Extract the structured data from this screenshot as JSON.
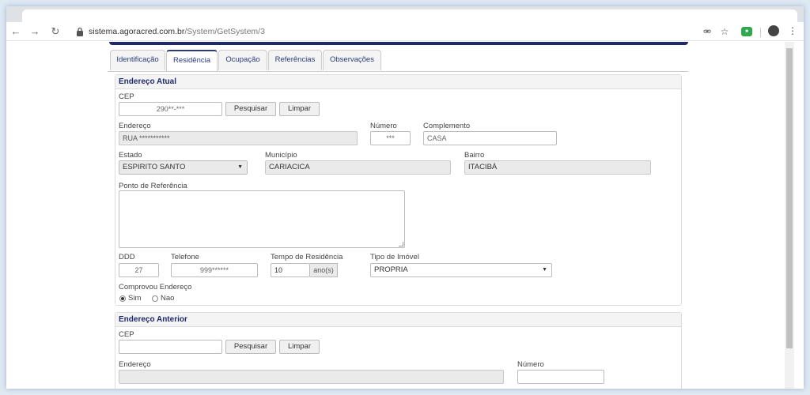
{
  "browser": {
    "url_host": "sistema.agoracred.com.br",
    "url_path": "/System/GetSystem/3"
  },
  "tabs": [
    {
      "label": "Identificação",
      "active": false
    },
    {
      "label": "Residência",
      "active": true
    },
    {
      "label": "Ocupação",
      "active": false
    },
    {
      "label": "Referências",
      "active": false
    },
    {
      "label": "Observações",
      "active": false
    }
  ],
  "endereco_atual": {
    "title": "Endereço Atual",
    "cep_label": "CEP",
    "cep_value": "290**-***",
    "pesquisar_label": "Pesquisar",
    "limpar_label": "Limpar",
    "endereco_label": "Endereço",
    "endereco_value": "RUA ***********",
    "numero_label": "Número",
    "numero_value": "***",
    "complemento_label": "Complemento",
    "complemento_value": "CASA",
    "estado_label": "Estado",
    "estado_value": "ESPIRITO SANTO",
    "municipio_label": "Município",
    "municipio_value": "CARIACICA",
    "bairro_label": "Bairro",
    "bairro_value": "ITACIBÁ",
    "referencia_label": "Ponto de Referência",
    "ddd_label": "DDD",
    "ddd_value": "27",
    "telefone_label": "Telefone",
    "telefone_value": "999******",
    "tempo_label": "Tempo de Residência",
    "tempo_value": "10",
    "tempo_unit": "ano(s)",
    "tipo_label": "Tipo de Imóvel",
    "tipo_value": "PROPRIA",
    "comprovou_label": "Comprovou Endereço",
    "sim_label": "Sim",
    "nao_label": "Nao",
    "comprovou_selected": "Sim"
  },
  "endereco_anterior": {
    "title": "Endereço Anterior",
    "cep_label": "CEP",
    "cep_value": "",
    "pesquisar_label": "Pesquisar",
    "limpar_label": "Limpar",
    "endereco_label": "Endereço",
    "numero_label": "Número"
  }
}
